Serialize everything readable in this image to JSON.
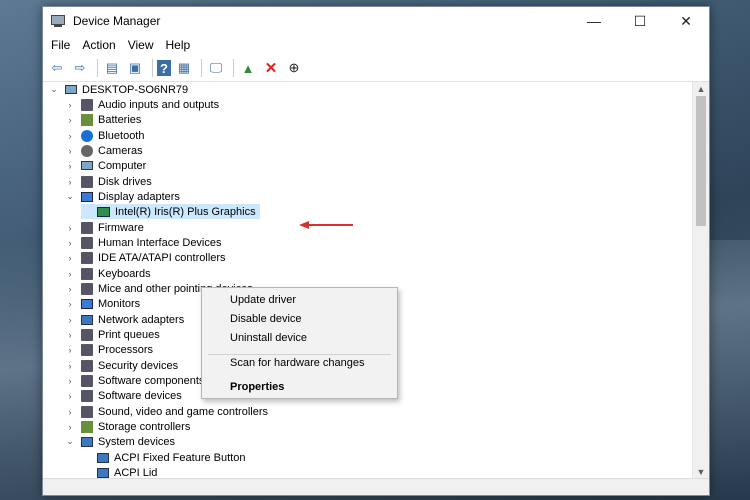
{
  "window": {
    "title": "Device Manager",
    "controls": {
      "minimize": "—",
      "maximize": "☐",
      "close": "✕"
    }
  },
  "menu": [
    "File",
    "Action",
    "View",
    "Help"
  ],
  "toolbar": {
    "icons": [
      "back-arrow-icon",
      "forward-arrow-icon",
      "properties-icon",
      "update-icon",
      "help-icon",
      "view-icon",
      "scan-icon",
      "add-driver-icon",
      "uninstall-x-icon",
      "download-icon"
    ]
  },
  "tree": {
    "root": "DESKTOP-SO6NR79",
    "items": [
      "Audio inputs and outputs",
      "Batteries",
      "Bluetooth",
      "Cameras",
      "Computer",
      "Disk drives",
      "Display adapters",
      "Intel(R) Iris(R) Plus Graphics",
      "Firmware",
      "Human Interface Devices",
      "IDE ATA/ATAPI controllers",
      "Keyboards",
      "Mice and other pointing devices",
      "Monitors",
      "Network adapters",
      "Print queues",
      "Processors",
      "Security devices",
      "Software components",
      "Software devices",
      "Sound, video and game controllers",
      "Storage controllers",
      "System devices",
      "ACPI Fixed Feature Button",
      "ACPI Lid"
    ]
  },
  "context_menu": {
    "update": "Update driver",
    "disable": "Disable device",
    "uninstall": "Uninstall device",
    "scan": "Scan for hardware changes",
    "properties": "Properties"
  },
  "colors": {
    "selection": "#cce8ff",
    "arrow": "#d9302c",
    "uninstall_x": "#e02020"
  }
}
